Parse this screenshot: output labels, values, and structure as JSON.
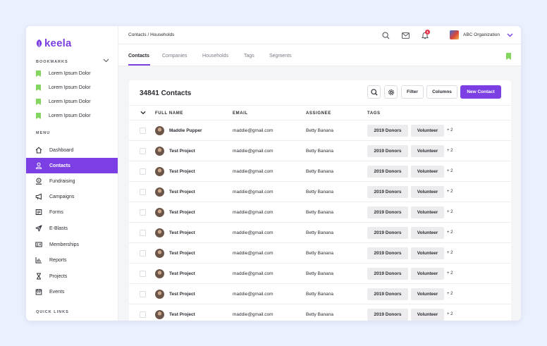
{
  "brand": {
    "name": "keela",
    "accent": "#7b3fe4",
    "bookmark_color": "#85d561"
  },
  "sidebar": {
    "bookmarks_label": "BOOKMARKS",
    "bookmarks": [
      {
        "label": "Lorem Ipsum Dolor"
      },
      {
        "label": "Lorem Ipsum Dolor"
      },
      {
        "label": "Lorem Ipsum Dolor"
      },
      {
        "label": "Lorem Ipsum Dolor"
      }
    ],
    "menu_label": "MENU",
    "menu": [
      {
        "label": "Dashboard",
        "icon": "home-icon"
      },
      {
        "label": "Contacts",
        "icon": "user-icon",
        "active": true
      },
      {
        "label": "Fundraising",
        "icon": "donate-icon"
      },
      {
        "label": "Campaigns",
        "icon": "megaphone-icon"
      },
      {
        "label": "Forms",
        "icon": "form-icon"
      },
      {
        "label": "E-Blasts",
        "icon": "send-icon"
      },
      {
        "label": "Memberships",
        "icon": "id-card-icon"
      },
      {
        "label": "Reports",
        "icon": "chart-icon"
      },
      {
        "label": "Projects",
        "icon": "hourglass-icon"
      },
      {
        "label": "Events",
        "icon": "calendar-icon"
      }
    ],
    "quick_links_label": "QUICK LINKS"
  },
  "topbar": {
    "breadcrumb": "Contacts / Households",
    "org_name": "ABC Organization",
    "notification_count": "1"
  },
  "tabs": [
    {
      "label": "Contacts",
      "active": true
    },
    {
      "label": "Companies"
    },
    {
      "label": "Households"
    },
    {
      "label": "Tags"
    },
    {
      "label": "Segments"
    }
  ],
  "card": {
    "title": "34841 Contacts",
    "filter_label": "Filter",
    "columns_label": "Columns",
    "new_contact_label": "New Contact"
  },
  "table": {
    "headers": {
      "name": "FULL NAME",
      "email": "EMAIL",
      "assignee": "ASSIGNEE",
      "tags": "TAGS"
    },
    "rows": [
      {
        "name": "Maddie Pupper",
        "email": "maddie@gmail.com",
        "assignee": "Betty Banana",
        "tag1": "2019 Donors",
        "tag2": "Volunteer",
        "more": "+ 2"
      },
      {
        "name": "Test Project",
        "email": "maddie@gmail.com",
        "assignee": "Betty Banana",
        "tag1": "2019 Donors",
        "tag2": "Volunteer",
        "more": "+ 2"
      },
      {
        "name": "Test Project",
        "email": "maddie@gmail.com",
        "assignee": "Betty Banana",
        "tag1": "2019 Donors",
        "tag2": "Volunteer",
        "more": "+ 2"
      },
      {
        "name": "Test Project",
        "email": "maddie@gmail.com",
        "assignee": "Betty Banana",
        "tag1": "2019 Donors",
        "tag2": "Volunteer",
        "more": "+ 2"
      },
      {
        "name": "Test Project",
        "email": "maddie@gmail.com",
        "assignee": "Betty Banana",
        "tag1": "2019 Donors",
        "tag2": "Volunteer",
        "more": "+ 2"
      },
      {
        "name": "Test Project",
        "email": "maddie@gmail.com",
        "assignee": "Betty Banana",
        "tag1": "2019 Donors",
        "tag2": "Volunteer",
        "more": "+ 2"
      },
      {
        "name": "Test Project",
        "email": "maddie@gmail.com",
        "assignee": "Betty Banana",
        "tag1": "2019 Donors",
        "tag2": "Volunteer",
        "more": "+ 2"
      },
      {
        "name": "Test Project",
        "email": "maddie@gmail.com",
        "assignee": "Betty Banana",
        "tag1": "2019 Donors",
        "tag2": "Volunteer",
        "more": "+ 2"
      },
      {
        "name": "Test Project",
        "email": "maddie@gmail.com",
        "assignee": "Betty Banana",
        "tag1": "2019 Donors",
        "tag2": "Volunteer",
        "more": "+ 2"
      },
      {
        "name": "Test Project",
        "email": "maddie@gmail.com",
        "assignee": "Betty Banana",
        "tag1": "2019 Donors",
        "tag2": "Volunteer",
        "more": "+ 2"
      }
    ]
  }
}
